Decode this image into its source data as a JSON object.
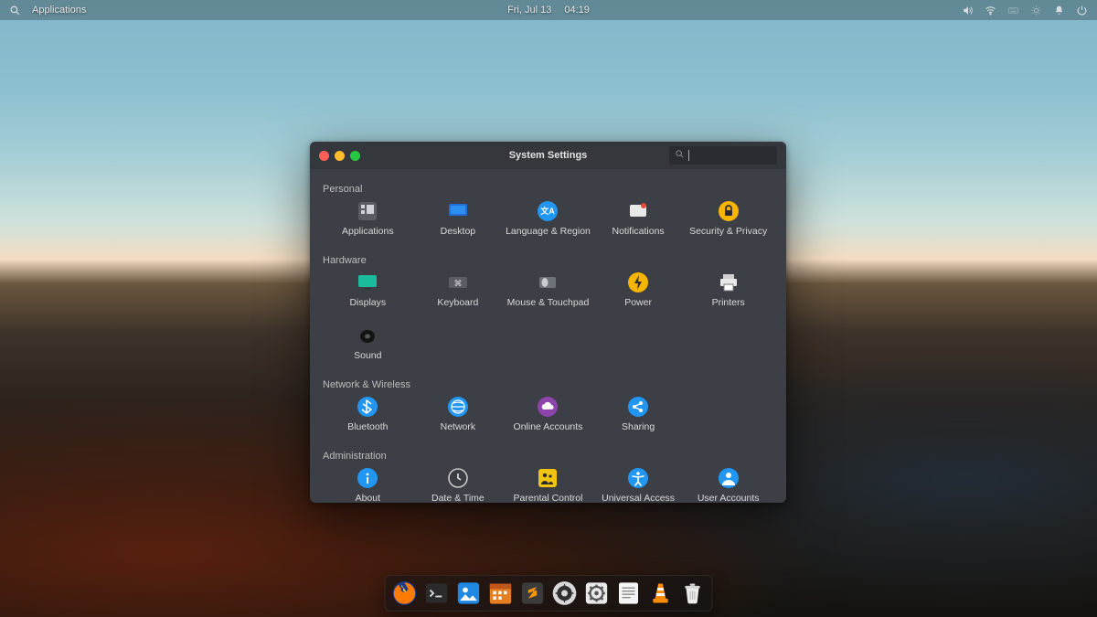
{
  "topbar": {
    "applications_label": "Applications",
    "date": "Fri, Jul 13",
    "time": "04:19",
    "indicators": [
      "volume",
      "wifi",
      "keyboard",
      "night-light",
      "notifications",
      "power"
    ]
  },
  "window": {
    "title": "System Settings",
    "search_placeholder": "",
    "categories": [
      {
        "label": "Personal",
        "items": [
          {
            "id": "applications",
            "label": "Applications"
          },
          {
            "id": "desktop",
            "label": "Desktop"
          },
          {
            "id": "language-region",
            "label": "Language & Region"
          },
          {
            "id": "notifications",
            "label": "Notifications"
          },
          {
            "id": "security-privacy",
            "label": "Security & Privacy"
          }
        ]
      },
      {
        "label": "Hardware",
        "items": [
          {
            "id": "displays",
            "label": "Displays"
          },
          {
            "id": "keyboard",
            "label": "Keyboard"
          },
          {
            "id": "mouse-touchpad",
            "label": "Mouse & Touchpad"
          },
          {
            "id": "power",
            "label": "Power"
          },
          {
            "id": "printers",
            "label": "Printers"
          },
          {
            "id": "sound",
            "label": "Sound"
          }
        ]
      },
      {
        "label": "Network & Wireless",
        "items": [
          {
            "id": "bluetooth",
            "label": "Bluetooth"
          },
          {
            "id": "network",
            "label": "Network"
          },
          {
            "id": "online-accounts",
            "label": "Online Accounts"
          },
          {
            "id": "sharing",
            "label": "Sharing"
          }
        ]
      },
      {
        "label": "Administration",
        "items": [
          {
            "id": "about",
            "label": "About"
          },
          {
            "id": "date-time",
            "label": "Date & Time"
          },
          {
            "id": "parental-control",
            "label": "Parental Control"
          },
          {
            "id": "universal-access",
            "label": "Universal Access"
          },
          {
            "id": "user-accounts",
            "label": "User Accounts"
          }
        ]
      }
    ]
  },
  "dock": {
    "apps": [
      {
        "id": "firefox",
        "label": "Firefox"
      },
      {
        "id": "terminal",
        "label": "Terminal"
      },
      {
        "id": "photos",
        "label": "Photos"
      },
      {
        "id": "calendar",
        "label": "Calendar"
      },
      {
        "id": "sublime",
        "label": "Sublime Text"
      },
      {
        "id": "system-settings",
        "label": "System Settings"
      },
      {
        "id": "tweaks",
        "label": "Tweaks"
      },
      {
        "id": "notes",
        "label": "Notes"
      },
      {
        "id": "vlc",
        "label": "VLC"
      },
      {
        "id": "trash",
        "label": "Trash"
      }
    ]
  }
}
